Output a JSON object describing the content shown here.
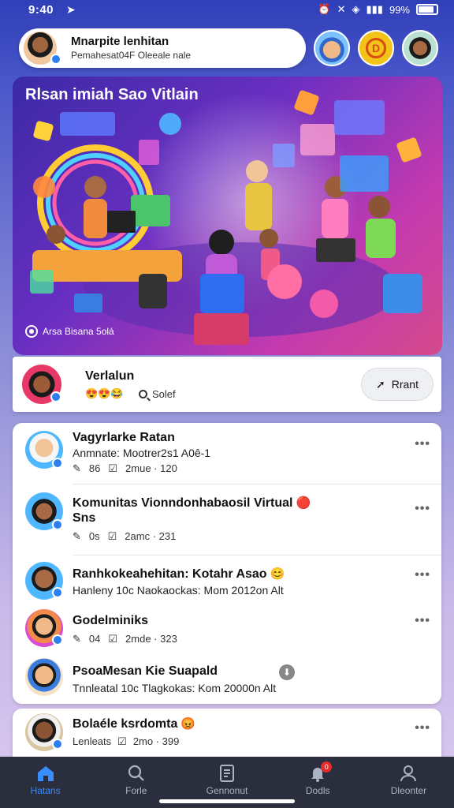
{
  "status_bar": {
    "time": "9:40",
    "battery": "99%"
  },
  "header": {
    "profile_name": "Mnarpite lenhitan",
    "profile_subtitle": "Pemahesat04F Oleeale nale"
  },
  "banner": {
    "title": "Rlsan imiah Sao Vitlain",
    "meta": "Arsa Bisana 5olá"
  },
  "featured": {
    "title": "Verlalun",
    "emojis": "😍😍😂",
    "sort_label": "Solef",
    "action_label": "Rrant"
  },
  "list": {
    "items": [
      {
        "title": "Vagyrlarke Ratan",
        "subtitle": "Anmnate: Mootrer2s1 A0ê-1",
        "stat1": "86",
        "stat2": "2mue · 120"
      },
      {
        "title": "Komunitas Vionndonhabaosil Virtual",
        "title2": "Sns",
        "badge": "🔴",
        "stat1": "0s",
        "stat2": "2amc · 231"
      },
      {
        "title": "Ranhkokeahehitan: Kotahr Asao",
        "badge": "😊",
        "subtitle": "Hanleny 10c Naokaockas: Mom 2012on Alt"
      },
      {
        "title": "Godelminiks",
        "stat1": "04",
        "stat2": "2mde · 323"
      },
      {
        "title": "PsoaMesan Kie Suapald",
        "subtitle": "Tnnleatal 10c Tlagkokas: Kom 20000n Alt"
      }
    ],
    "last_item": {
      "title": "Bolaéle ksrdomta",
      "badge": "😡",
      "subtitle": "Lenleats",
      "stat": "2mo · 399"
    }
  },
  "nav": {
    "items": [
      {
        "label": "Hatans",
        "icon": "home-icon"
      },
      {
        "label": "Forle",
        "icon": "search-icon"
      },
      {
        "label": "Gennonut",
        "icon": "document-icon"
      },
      {
        "label": "Dodls",
        "icon": "bell-icon",
        "badge": "0"
      },
      {
        "label": "Dleonter",
        "icon": "profile-icon"
      }
    ]
  },
  "colors": {
    "accent": "#3a8dff",
    "nav_bg": "#2a2e3d",
    "verify": "#2d7ff0"
  }
}
